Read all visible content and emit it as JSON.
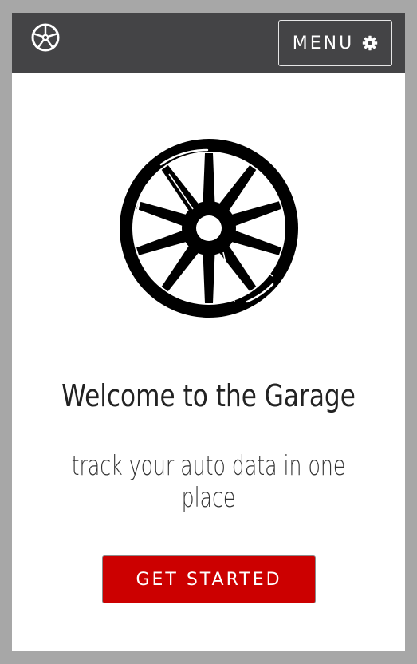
{
  "header": {
    "logo_icon": "wheel-icon",
    "menu_label": "MENU",
    "menu_icon": "gear-icon"
  },
  "hero": {
    "icon": "wheel-icon",
    "title": "Welcome to the Garage",
    "subtitle": "track your auto data in one place"
  },
  "cta": {
    "label": "GET STARTED"
  },
  "colors": {
    "page_bg": "#a7a7a7",
    "header_bg": "#444446",
    "accent": "#cc0000"
  }
}
